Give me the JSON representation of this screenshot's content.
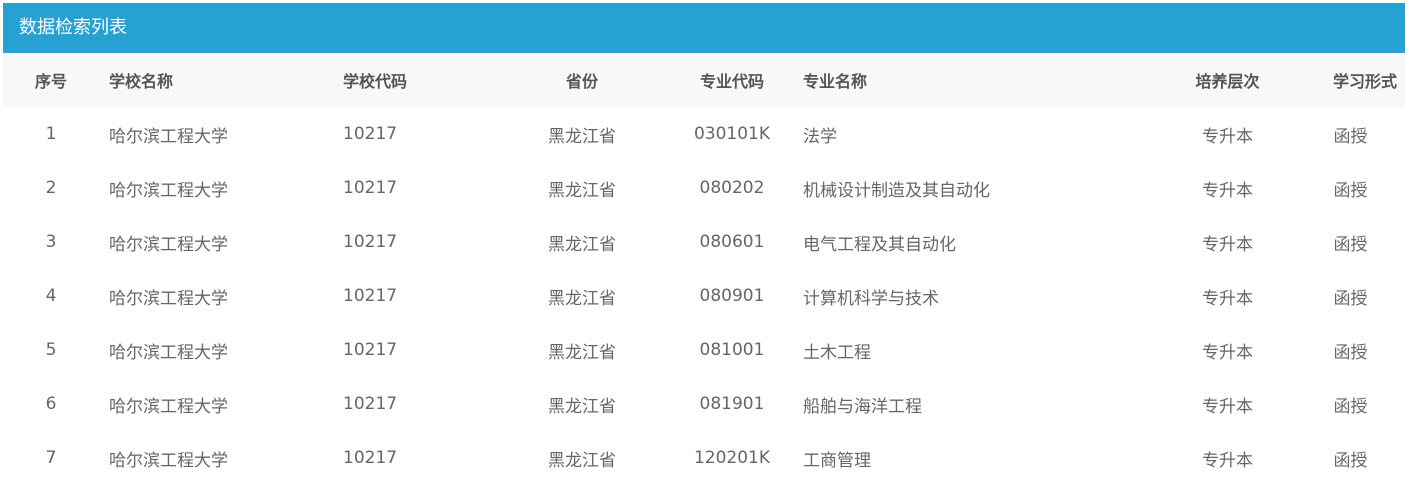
{
  "header": {
    "title": "数据检索列表"
  },
  "table": {
    "columns": [
      "序号",
      "学校名称",
      "学校代码",
      "省份",
      "专业代码",
      "专业名称",
      "培养层次",
      "学习形式"
    ],
    "rows": [
      [
        "1",
        "哈尔滨工程大学",
        "10217",
        "黑龙江省",
        "030101K",
        "法学",
        "专升本",
        "函授"
      ],
      [
        "2",
        "哈尔滨工程大学",
        "10217",
        "黑龙江省",
        "080202",
        "机械设计制造及其自动化",
        "专升本",
        "函授"
      ],
      [
        "3",
        "哈尔滨工程大学",
        "10217",
        "黑龙江省",
        "080601",
        "电气工程及其自动化",
        "专升本",
        "函授"
      ],
      [
        "4",
        "哈尔滨工程大学",
        "10217",
        "黑龙江省",
        "080901",
        "计算机科学与技术",
        "专升本",
        "函授"
      ],
      [
        "5",
        "哈尔滨工程大学",
        "10217",
        "黑龙江省",
        "081001",
        "土木工程",
        "专升本",
        "函授"
      ],
      [
        "6",
        "哈尔滨工程大学",
        "10217",
        "黑龙江省",
        "081901",
        "船舶与海洋工程",
        "专升本",
        "函授"
      ],
      [
        "7",
        "哈尔滨工程大学",
        "10217",
        "黑龙江省",
        "120201K",
        "工商管理",
        "专升本",
        "函授"
      ]
    ]
  },
  "colors": {
    "header_bg": "#27a0d2",
    "header_text": "#ffffff",
    "thead_bg": "#f8f8f8",
    "text": "#666666"
  }
}
